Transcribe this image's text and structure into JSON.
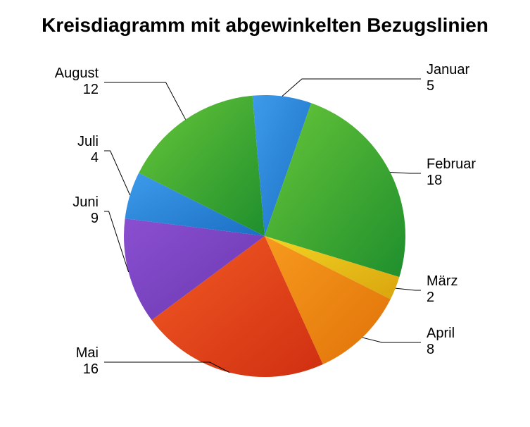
{
  "chart_data": {
    "type": "pie",
    "title": "Kreisdiagramm mit abgewinkelten Bezugslinien",
    "series": [
      {
        "name": "Januar",
        "value": 5,
        "color1": "#3d9bea",
        "color2": "#1b6fc4"
      },
      {
        "name": "Februar",
        "value": 18,
        "color1": "#67c639",
        "color2": "#1f8f2d"
      },
      {
        "name": "März",
        "value": 2,
        "color1": "#f3d423",
        "color2": "#d9a50e"
      },
      {
        "name": "April",
        "value": 8,
        "color1": "#f79a1e",
        "color2": "#e07208"
      },
      {
        "name": "Mai",
        "value": 16,
        "color1": "#f15a24",
        "color2": "#d02f11"
      },
      {
        "name": "Juni",
        "value": 9,
        "color1": "#8a4fd0",
        "color2": "#6a38b0"
      },
      {
        "name": "Juli",
        "value": 4,
        "color1": "#3d9bea",
        "color2": "#1b6fc4"
      },
      {
        "name": "August",
        "value": 12,
        "color1": "#67c639",
        "color2": "#1f8f2d"
      }
    ]
  },
  "labels": {
    "jan": {
      "name": "Januar",
      "value": "5"
    },
    "feb": {
      "name": "Februar",
      "value": "18"
    },
    "mar": {
      "name": "März",
      "value": "2"
    },
    "apr": {
      "name": "April",
      "value": "8"
    },
    "mai": {
      "name": "Mai",
      "value": "16"
    },
    "jun": {
      "name": "Juni",
      "value": "9"
    },
    "jul": {
      "name": "Juli",
      "value": "4"
    },
    "aug": {
      "name": "August",
      "value": "12"
    }
  }
}
